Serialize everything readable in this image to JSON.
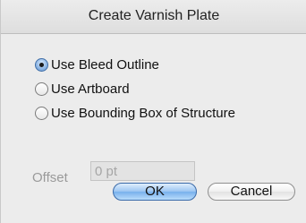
{
  "dialog": {
    "title": "Create Varnish Plate"
  },
  "options": [
    {
      "label": "Use Bleed Outline",
      "selected": true
    },
    {
      "label": "Use Artboard",
      "selected": false
    },
    {
      "label": "Use Bounding Box of Structure",
      "selected": false
    }
  ],
  "offset": {
    "label": "Offset",
    "value": "0 pt",
    "enabled": false
  },
  "buttons": {
    "ok_label": "OK",
    "cancel_label": "Cancel"
  },
  "colors": {
    "default_button": "#9dc6f2",
    "selected_radio": "#5d8fcb",
    "disabled_text": "#9a9a9a"
  }
}
